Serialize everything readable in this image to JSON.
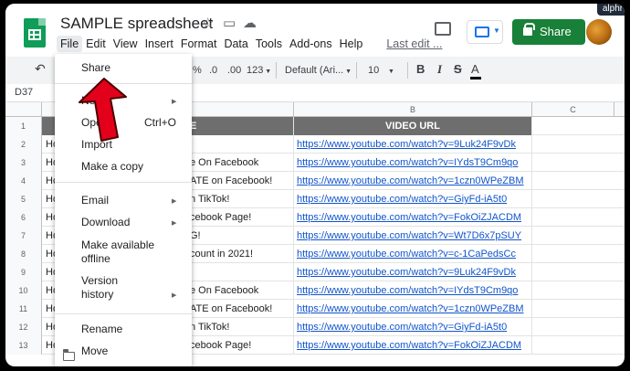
{
  "header": {
    "doc_title": "SAMPLE spreadsheet",
    "watermark": "alphr",
    "share_label": "Share",
    "menus": [
      "File",
      "Edit",
      "View",
      "Insert",
      "Format",
      "Data",
      "Tools",
      "Add-ons",
      "Help"
    ],
    "last_edit": "Last edit ..."
  },
  "toolbar": {
    "percent": "%",
    "dec_less": ".0",
    "dec_more": ".00",
    "number_format": "123",
    "font": "Default (Ari...",
    "font_size": "10",
    "bold": "B",
    "italic": "I",
    "strike": "S",
    "text_color": "A",
    "text_color_value": "#000000"
  },
  "name_box": "D37",
  "grid": {
    "col_headers": [
      "B",
      "C"
    ],
    "header_row": {
      "num": "1",
      "a_tail": "E",
      "b": "VIDEO URL"
    },
    "rows": [
      {
        "num": "2",
        "a": "Ho",
        "a_tail": "",
        "b": "https://www.youtube.com/watch?v=9Luk24F9vDk"
      },
      {
        "num": "3",
        "a": "Ho",
        "a_tail": "e On Facebook",
        "b": "https://www.youtube.com/watch?v=IYdsT9Cm9qo"
      },
      {
        "num": "4",
        "a": "Ho",
        "a_tail": "ATE on Facebook!",
        "b": "https://www.youtube.com/watch?v=1czn0WPeZBM"
      },
      {
        "num": "5",
        "a": "Ho",
        "a_tail": "n TikTok!",
        "b": "https://www.youtube.com/watch?v=GiyFd-iA5t0"
      },
      {
        "num": "6",
        "a": "Ho",
        "a_tail": "cebook Page!",
        "b": "https://www.youtube.com/watch?v=FokOiZJACDM"
      },
      {
        "num": "7",
        "a": "Ho",
        "a_tail": "G!",
        "b": "https://www.youtube.com/watch?v=Wt7D6x7pSUY"
      },
      {
        "num": "8",
        "a": "Ho",
        "a_tail": "count in 2021!",
        "b": "https://www.youtube.com/watch?v=c-1CaPedsCc"
      },
      {
        "num": "9",
        "a": "Ho",
        "a_tail": "",
        "b": "https://www.youtube.com/watch?v=9Luk24F9vDk"
      },
      {
        "num": "10",
        "a": "Ho",
        "a_tail": "e On Facebook",
        "b": "https://www.youtube.com/watch?v=IYdsT9Cm9qo"
      },
      {
        "num": "11",
        "a": "Ho",
        "a_tail": "ATE on Facebook!",
        "b": "https://www.youtube.com/watch?v=1czn0WPeZBM"
      },
      {
        "num": "12",
        "a": "Ho",
        "a_tail": "n TikTok!",
        "b": "https://www.youtube.com/watch?v=GiyFd-iA5t0"
      },
      {
        "num": "13",
        "a": "Ho",
        "a_tail": "cebook Page!",
        "b": "https://www.youtube.com/watch?v=FokOiZJACDM"
      }
    ]
  },
  "file_menu": {
    "share": "Share",
    "new": "Ne",
    "open": "Open",
    "open_shortcut": "Ctrl+O",
    "import": "Import",
    "make_copy": "Make a copy",
    "email": "Email",
    "download": "Download",
    "make_offline_1": "Make available",
    "make_offline_2": "offline",
    "version_1": "Version",
    "version_2": "history",
    "rename": "Rename",
    "move": "Move"
  },
  "colors": {
    "share_button": "#188038",
    "header_fill": "#6e6e6e",
    "link": "#1155cc",
    "annotation_arrow": "#e3001b"
  }
}
